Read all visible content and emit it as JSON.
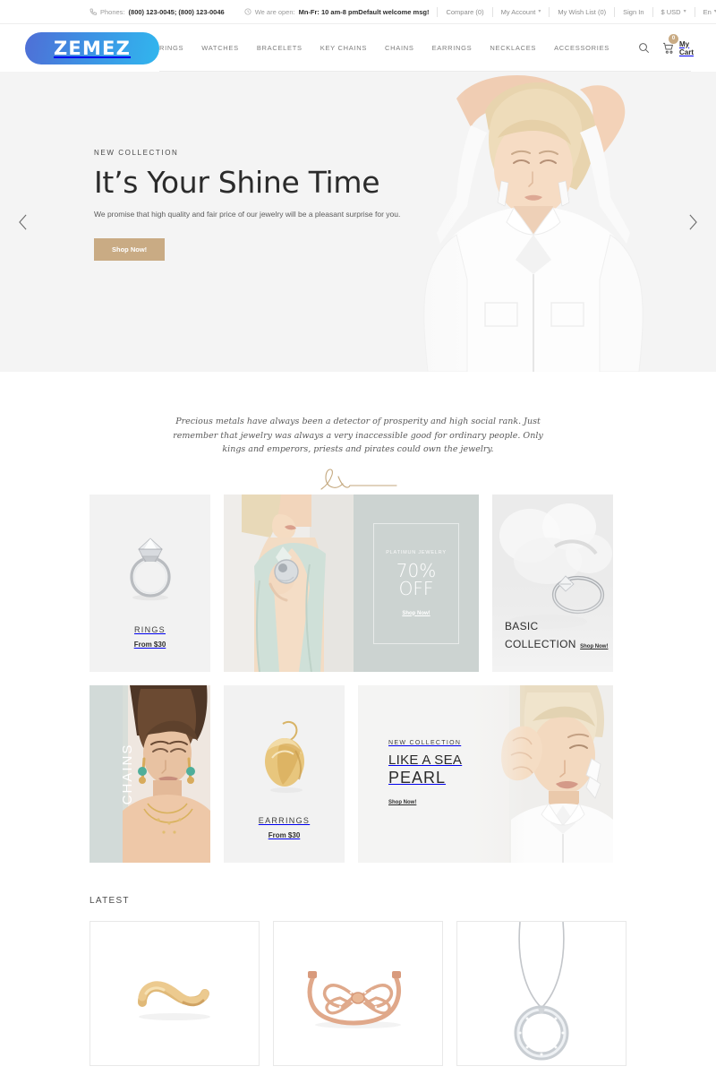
{
  "topbar": {
    "phones_label": "Phones:",
    "phones_value": "(800) 123-0045; (800) 123-0046",
    "hours_label": "We are open:",
    "hours_value": "Mn-Fr: 10 am-8 pm",
    "links": [
      {
        "label": "Default welcome msg!",
        "caret": ""
      },
      {
        "label": "Compare (0)",
        "caret": ""
      },
      {
        "label": "My Account",
        "caret": "▾"
      },
      {
        "label": "My Wish List (0)",
        "caret": ""
      },
      {
        "label": "Sign In",
        "caret": ""
      },
      {
        "label": "$ USD",
        "caret": "▾"
      },
      {
        "label": "En",
        "caret": "▾"
      }
    ]
  },
  "header": {
    "logo_text": "ZEMEZ",
    "nav": [
      "RINGS",
      "WATCHES",
      "BRACELETS",
      "KEY CHAINS",
      "CHAINS",
      "EARRINGS",
      "NECKLACES",
      "ACCESSORIES"
    ],
    "search_icon": "search-icon",
    "cart_icon": "cart-icon",
    "cart_count": "0",
    "cart_label": "My Cart"
  },
  "hero": {
    "eyebrow": "NEW COLLECTION",
    "title": "It’s Your Shine Time",
    "subtitle": "We promise that high quality and fair price of our jewelry will be a pleasant surprise for you.",
    "button": "Shop Now!",
    "prev_icon": "chevron-left-icon",
    "next_icon": "chevron-right-icon",
    "accent_color": "#c9ab84",
    "background_color": "#f4f4f4"
  },
  "quote": {
    "text": "Precious metals have always been a detector of prosperity and high social rank. Just remember that jewelry was always a very inaccessible good for ordinary people. Only kings and emperors, priests and pirates could own the jewelry.",
    "signature_color": "#c3a77d"
  },
  "banners": {
    "rings": {
      "name": "RINGS",
      "price": "From $30"
    },
    "promo": {
      "kicker": "PLATIMUN JEWELRY",
      "line1": "70%",
      "line2": "OFF",
      "cta": "Shop Now!",
      "panel_color": "#ccd3d1"
    },
    "basic": {
      "line1": "BASIC",
      "line2": "COLLECTION",
      "cta": "Shop Now!"
    },
    "chains": {
      "label": "CHAINS",
      "band_color": "#d2dad8"
    },
    "earrings": {
      "name": "EARRINGS",
      "price": "From $30"
    },
    "pearl": {
      "kicker": "NEW COLLECTION",
      "line1": "LIKE A SEA",
      "line2": "PEARL",
      "cta": "Shop Now!"
    }
  },
  "latest": {
    "title": "LATEST",
    "products": [
      {
        "name": "gold-infinity-ring"
      },
      {
        "name": "rose-gold-bow-bracelet"
      },
      {
        "name": "diamond-circle-pendant-necklace"
      }
    ]
  }
}
